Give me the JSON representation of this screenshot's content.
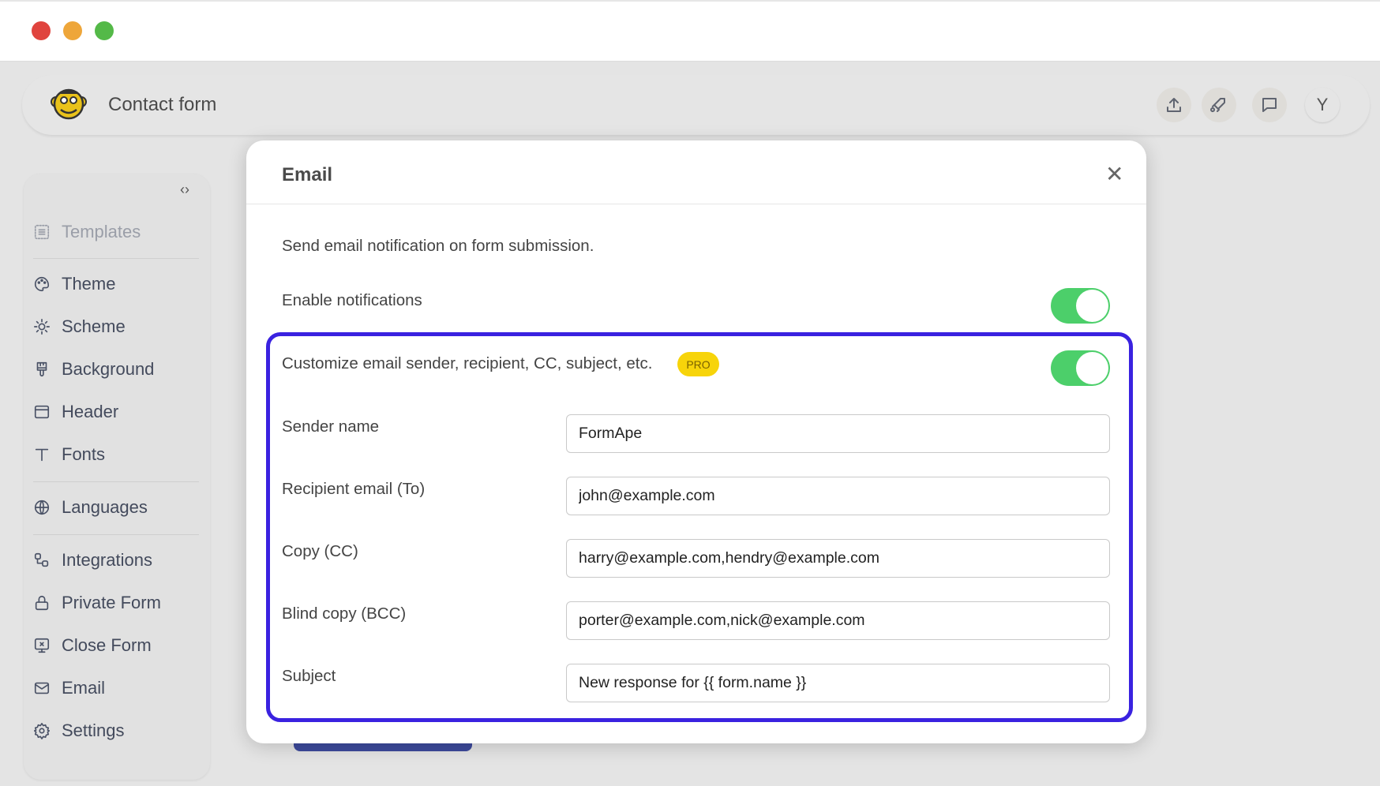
{
  "window": {
    "controls": {
      "close_color": "#e0443e",
      "minimize_color": "#eea63a",
      "maximize_color": "#54b948"
    }
  },
  "header": {
    "title": "Contact form",
    "actions": [
      {
        "icon": "upload-icon"
      },
      {
        "icon": "rocket-icon"
      },
      {
        "icon": "chat-icon"
      }
    ],
    "avatar_letter": "Y"
  },
  "sidebar": {
    "collapse_icon": "code-chevrons-icon",
    "items": [
      {
        "label": "Templates",
        "icon": "templates-icon"
      },
      {
        "label": "Theme",
        "icon": "palette-icon"
      },
      {
        "label": "Scheme",
        "icon": "sun-icon"
      },
      {
        "label": "Background",
        "icon": "brush-icon"
      },
      {
        "label": "Header",
        "icon": "header-icon"
      },
      {
        "label": "Fonts",
        "icon": "type-icon"
      },
      {
        "label": "Languages",
        "icon": "globe-icon"
      },
      {
        "label": "Integrations",
        "icon": "integrations-icon"
      },
      {
        "label": "Private Form",
        "icon": "lock-icon"
      },
      {
        "label": "Close Form",
        "icon": "monitor-x-icon"
      },
      {
        "label": "Email",
        "icon": "mail-icon"
      },
      {
        "label": "Settings",
        "icon": "gear-icon"
      }
    ]
  },
  "modal": {
    "title": "Email",
    "description": "Send email notification on form submission.",
    "enable_label": "Enable notifications",
    "enable_on": true,
    "customize_label": "Customize email sender, recipient, CC, subject, etc.",
    "customize_on": true,
    "pro_badge": "PRO",
    "fields": [
      {
        "label": "Sender name",
        "value": "FormApe"
      },
      {
        "label": "Recipient email (To)",
        "value": "john@example.com"
      },
      {
        "label": "Copy (CC)",
        "value": "harry@example.com,hendry@example.com"
      },
      {
        "label": "Blind copy (BCC)",
        "value": "porter@example.com,nick@example.com"
      },
      {
        "label": "Subject",
        "value": "New response for {{ form.name }}"
      }
    ]
  },
  "colors": {
    "toggle_on": "#4ccf6a",
    "highlight": "#3a22e0",
    "pro": "#f7d40a"
  }
}
